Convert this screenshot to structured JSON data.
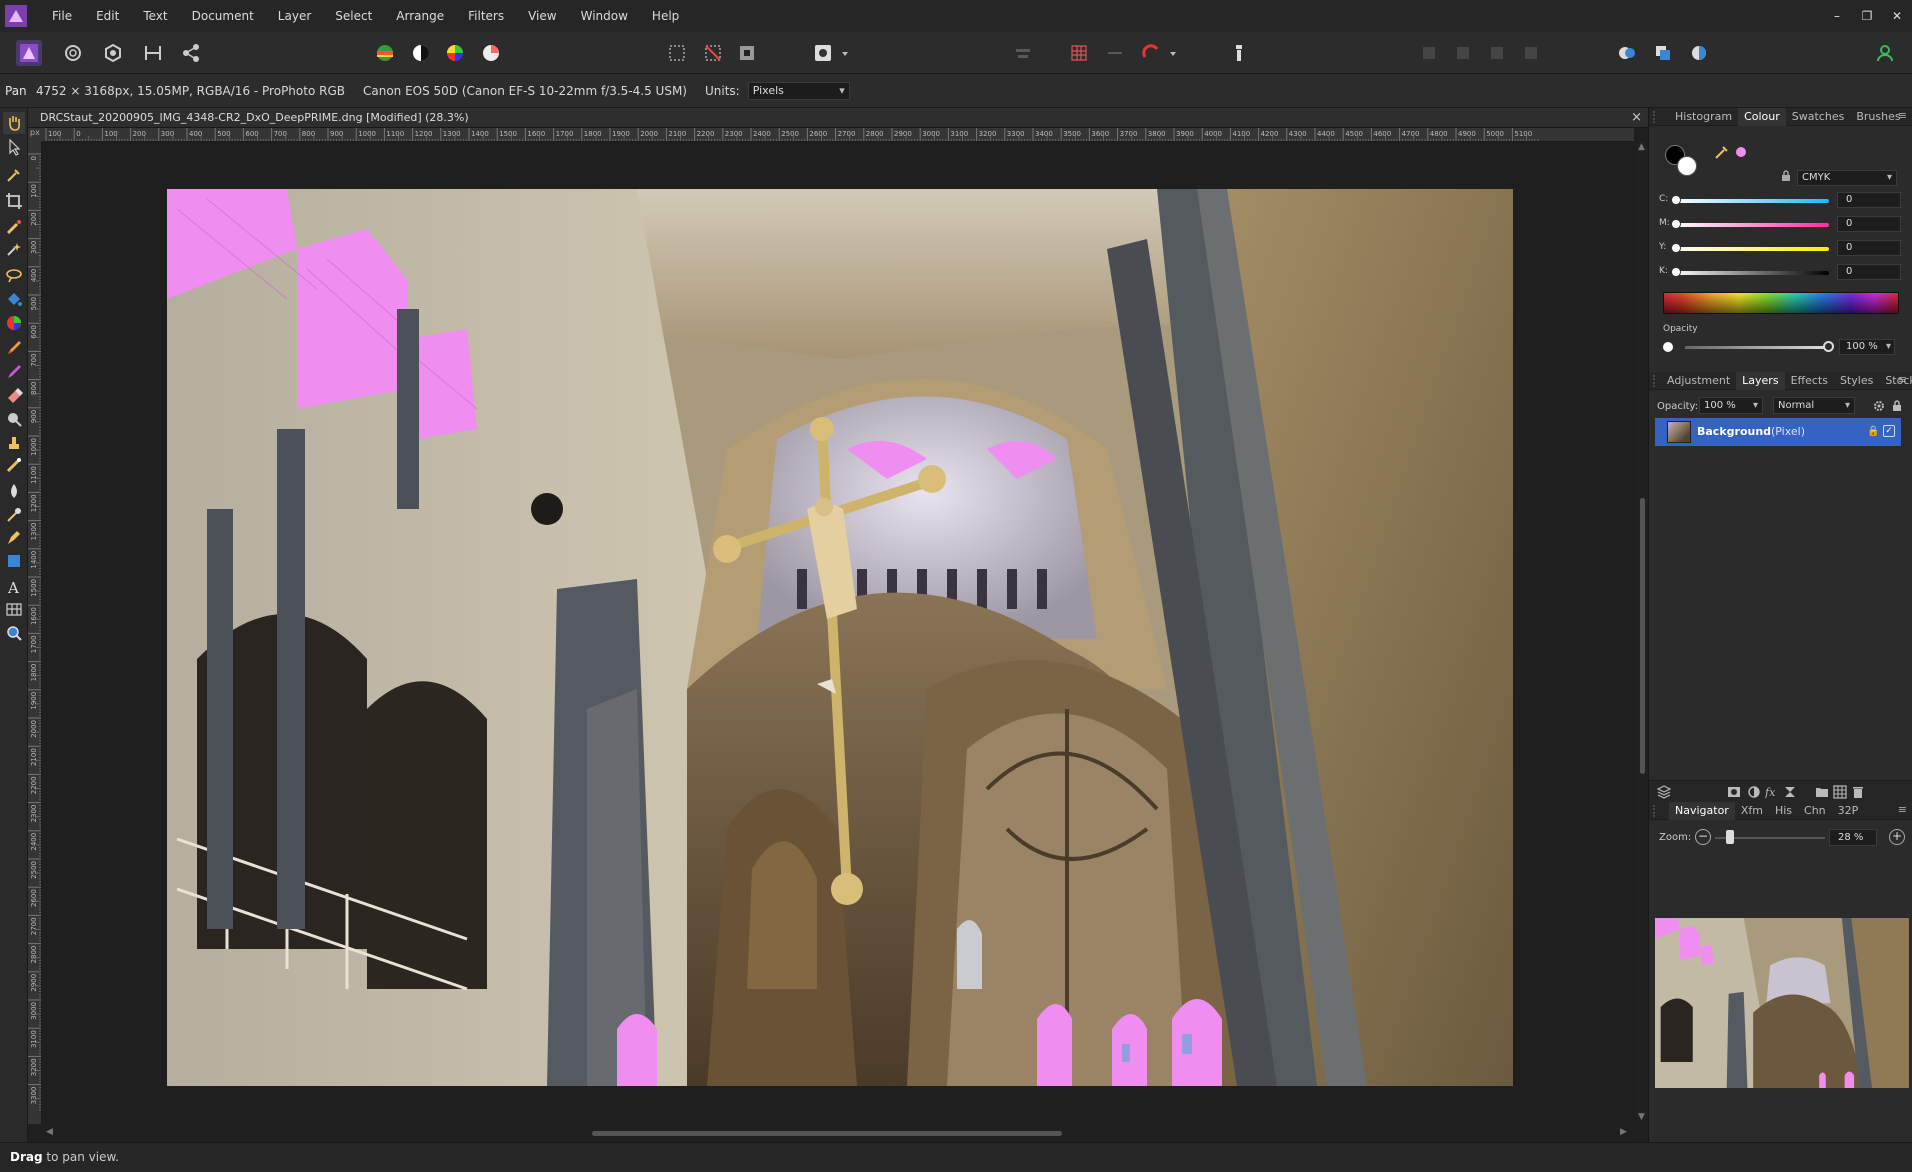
{
  "app": {
    "name": "Affinity Photo"
  },
  "menu": {
    "items": [
      "File",
      "Edit",
      "Text",
      "Document",
      "Layer",
      "Select",
      "Arrange",
      "Filters",
      "View",
      "Window",
      "Help"
    ]
  },
  "window_controls": {
    "minimize": "–",
    "restore": "❐",
    "close": "✕"
  },
  "context": {
    "tool": "Pan",
    "image_info": "4752 × 3168px, 15.05MP, RGBA/16 - ProPhoto RGB",
    "camera_info": "Canon EOS 50D (Canon EF-S 10-22mm f/3.5-4.5 USM)",
    "units_label": "Units:",
    "units_value": "Pixels"
  },
  "document": {
    "title": "DRCStaut_20200905_IMG_4348-CR2_DxO_DeepPRIME.dng [Modified] (28.3%)",
    "close": "×",
    "ruler_unit": "px",
    "ruler_top_ticks": [
      "100",
      "0",
      "100",
      "200",
      "300",
      "400",
      "500",
      "600",
      "700",
      "800",
      "900",
      "1000",
      "1100",
      "1200",
      "1300",
      "1400",
      "1500",
      "1600",
      "1700",
      "1800",
      "1900",
      "2000",
      "2100",
      "2200",
      "2300",
      "2400",
      "2500",
      "2600",
      "2700",
      "2800",
      "2900",
      "3000",
      "3100",
      "3200",
      "3300",
      "3400",
      "3500",
      "3600",
      "3700",
      "3800",
      "3900",
      "4000",
      "4100",
      "4200",
      "4300",
      "4400",
      "4500",
      "4600",
      "4700",
      "4800",
      "4900",
      "5000",
      "5100"
    ],
    "ruler_left_ticks": [
      "0",
      "100",
      "200",
      "300",
      "400",
      "500",
      "600",
      "700",
      "800",
      "900",
      "1000",
      "1100",
      "1200",
      "1300",
      "1400",
      "1500",
      "1600",
      "1700",
      "1800",
      "1900",
      "2000",
      "2100",
      "2200",
      "2300",
      "2400",
      "2500",
      "2600",
      "2700",
      "2800",
      "2900",
      "3000",
      "3100",
      "3200",
      "3300"
    ]
  },
  "colour_panel": {
    "tabs": [
      "Histogram",
      "Colour",
      "Swatches",
      "Brushes"
    ],
    "active_tab": "Colour",
    "model": "CMYK",
    "sliders": [
      {
        "label": "C:",
        "value": "0",
        "gradient": [
          "#ffffff",
          "#1fb8ff"
        ]
      },
      {
        "label": "M:",
        "value": "0",
        "gradient": [
          "#ffffff",
          "#ff2da3"
        ]
      },
      {
        "label": "Y:",
        "value": "0",
        "gradient": [
          "#ffffff",
          "#ffee00"
        ]
      },
      {
        "label": "K:",
        "value": "0",
        "gradient": [
          "#ffffff",
          "#000000"
        ]
      }
    ],
    "opacity_label": "Opacity",
    "opacity_value": "100 %"
  },
  "layers_panel": {
    "tabs": [
      "Adjustment",
      "Layers",
      "Effects",
      "Styles",
      "Stock"
    ],
    "active_tab": "Layers",
    "opacity_label": "Opacity:",
    "opacity_value": "100 %",
    "blend_mode": "Normal",
    "layers": [
      {
        "name": "Background",
        "type": "(Pixel)",
        "visible_check": "✓"
      }
    ]
  },
  "navigator_panel": {
    "tabs": [
      "Navigator",
      "Xfm",
      "His",
      "Chn",
      "32P"
    ],
    "active_tab": "Navigator",
    "zoom_label": "Zoom:",
    "zoom_value": "28 %",
    "zoom_level": 0.28
  },
  "status": {
    "bold": "Drag",
    "text": " to pan view."
  },
  "colors": {
    "accent": "#3563c1",
    "selection_pink": "#ef8df0"
  }
}
